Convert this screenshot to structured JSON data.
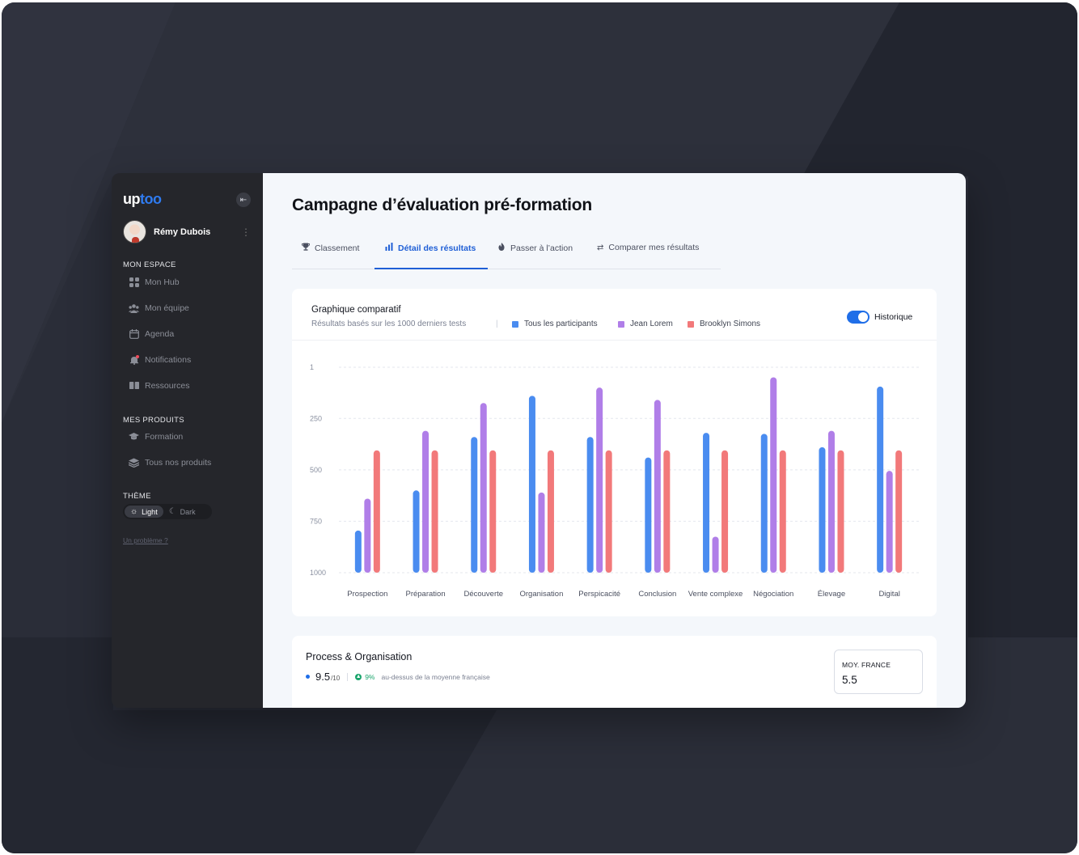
{
  "brand": {
    "part1": "up",
    "part2": "too"
  },
  "sidebar": {
    "collapse_icon": "collapse-left-icon",
    "user_name": "Rémy Dubois",
    "section_mon_espace": "MON ESPACE",
    "nav": [
      {
        "label": "Mon Hub",
        "icon": "grid-icon"
      },
      {
        "label": "Mon équipe",
        "icon": "team-icon"
      },
      {
        "label": "Agenda",
        "icon": "calendar-icon"
      },
      {
        "label": "Notifications",
        "icon": "bell-icon"
      },
      {
        "label": "Ressources",
        "icon": "book-icon"
      }
    ],
    "section_produits": "MES PRODUITS",
    "products": [
      {
        "label": "Formation",
        "icon": "graduation-cap-icon"
      },
      {
        "label": "Tous nos produits",
        "icon": "layers-icon"
      }
    ],
    "section_theme": "THÈME",
    "theme_light": "Light",
    "theme_dark": "Dark",
    "problem_link": "Un problème ?"
  },
  "page": {
    "title": "Campagne d’évaluation pré-formation"
  },
  "tabs": [
    {
      "label": "Classement",
      "icon": "trophy-icon",
      "active": false
    },
    {
      "label": "Détail des résultats",
      "icon": "bar-chart-icon",
      "active": true
    },
    {
      "label": "Passer à l’action",
      "icon": "flame-icon",
      "active": false
    },
    {
      "label": "Comparer mes résultats",
      "icon": "swap-icon",
      "active": false
    }
  ],
  "chart_card": {
    "title": "Graphique comparatif",
    "subtitle": "Résultats basés sur les 1000 derniers tests",
    "separator": "|",
    "toggle_label": "Historique",
    "toggle_on": true
  },
  "colors": {
    "series1": "#4a8cf0",
    "series2": "#b07ee8",
    "series3": "#f2797a",
    "accent": "#1f6ee8"
  },
  "chart_data": {
    "type": "bar",
    "categories": [
      "Prospection",
      "Préparation",
      "Découverte",
      "Organisation",
      "Perspicacité",
      "Conclusion",
      "Vente complexe",
      "Négociation",
      "Élevage",
      "Digital"
    ],
    "yticks": [
      "1",
      "250",
      "500",
      "750",
      "1000"
    ],
    "ylim": [
      1,
      1000
    ],
    "y_inverted": true,
    "grid": true,
    "legend_position": "top",
    "series": [
      {
        "name": "Tous les participants",
        "values": [
          795,
          600,
          340,
          140,
          340,
          440,
          320,
          325,
          390,
          95
        ]
      },
      {
        "name": "Jean Lorem",
        "values": [
          640,
          310,
          175,
          610,
          100,
          160,
          825,
          50,
          310,
          505
        ]
      },
      {
        "name": "Brooklyn Simons",
        "values": [
          405,
          405,
          405,
          405,
          405,
          405,
          405,
          405,
          405,
          405
        ]
      }
    ]
  },
  "process": {
    "title": "Process & Organisation",
    "score": "9.5",
    "score_max": "/10",
    "delta": "9%",
    "delta_text": "au-dessus de la moyenne française",
    "moy_label": "MOY. FRANCE",
    "moy_value": "5.5"
  }
}
